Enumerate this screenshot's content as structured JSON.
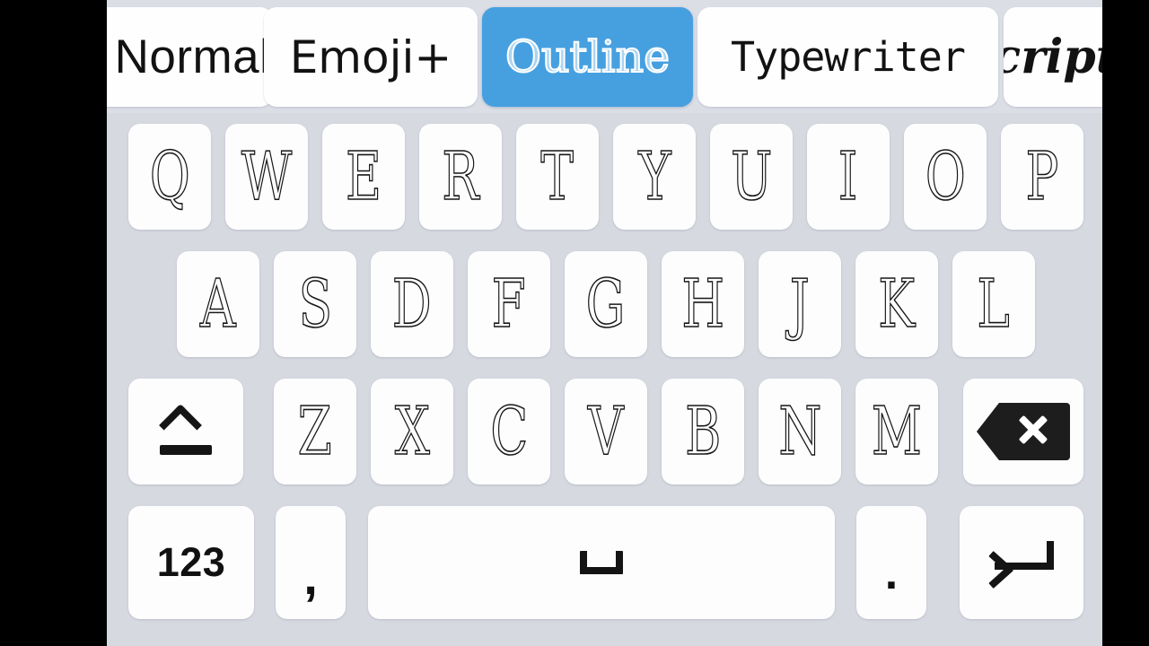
{
  "app": {
    "background_color": "#000000",
    "keyboard_background": "#d7d9e1",
    "style_bar_background": "#dcdee6",
    "key_color": "#fdfdfe",
    "accent_color": "#46a0e0",
    "text_color": "#161616"
  },
  "style_bar": {
    "name": "font-style-selector",
    "tabs": [
      {
        "id": "normal",
        "label": "Normal",
        "selected": false,
        "clipped": true
      },
      {
        "id": "emoji-plus",
        "label": "Emoji+",
        "selected": false,
        "clipped": false
      },
      {
        "id": "outline",
        "label": "Outline",
        "selected": true,
        "clipped": false
      },
      {
        "id": "typewriter",
        "label": "Typewriter",
        "selected": false,
        "clipped": false
      },
      {
        "id": "script",
        "label": "script",
        "selected": false,
        "clipped": true
      }
    ],
    "selected_tab": "Outline"
  },
  "keyboard": {
    "name": "qwerty-keyboard",
    "layout": "QWERTY",
    "case": "uppercase",
    "rows": [
      {
        "id": "row-1",
        "keys": [
          {
            "id": "q",
            "label": "Q"
          },
          {
            "id": "w",
            "label": "W"
          },
          {
            "id": "e",
            "label": "E"
          },
          {
            "id": "r",
            "label": "R"
          },
          {
            "id": "t",
            "label": "T"
          },
          {
            "id": "y",
            "label": "Y"
          },
          {
            "id": "u",
            "label": "U"
          },
          {
            "id": "i",
            "label": "I"
          },
          {
            "id": "o",
            "label": "O"
          },
          {
            "id": "p",
            "label": "P"
          }
        ]
      },
      {
        "id": "row-2",
        "keys": [
          {
            "id": "a",
            "label": "A"
          },
          {
            "id": "s",
            "label": "S"
          },
          {
            "id": "d",
            "label": "D"
          },
          {
            "id": "f",
            "label": "F"
          },
          {
            "id": "g",
            "label": "G"
          },
          {
            "id": "h",
            "label": "H"
          },
          {
            "id": "j",
            "label": "J"
          },
          {
            "id": "k",
            "label": "K"
          },
          {
            "id": "l",
            "label": "L"
          }
        ]
      },
      {
        "id": "row-3",
        "keys": [
          {
            "id": "shift",
            "label": "",
            "icon": "shift-icon"
          },
          {
            "id": "z",
            "label": "Z"
          },
          {
            "id": "x",
            "label": "X"
          },
          {
            "id": "c",
            "label": "C"
          },
          {
            "id": "v",
            "label": "V"
          },
          {
            "id": "b",
            "label": "B"
          },
          {
            "id": "n",
            "label": "N"
          },
          {
            "id": "m",
            "label": "M"
          },
          {
            "id": "backspace",
            "label": "",
            "icon": "backspace-icon"
          }
        ]
      },
      {
        "id": "row-4",
        "keys": [
          {
            "id": "numbers",
            "label": "123"
          },
          {
            "id": "comma",
            "label": ","
          },
          {
            "id": "space",
            "label": "",
            "icon": "space-icon"
          },
          {
            "id": "period",
            "label": "."
          },
          {
            "id": "enter",
            "label": "",
            "icon": "enter-icon"
          }
        ]
      }
    ]
  }
}
